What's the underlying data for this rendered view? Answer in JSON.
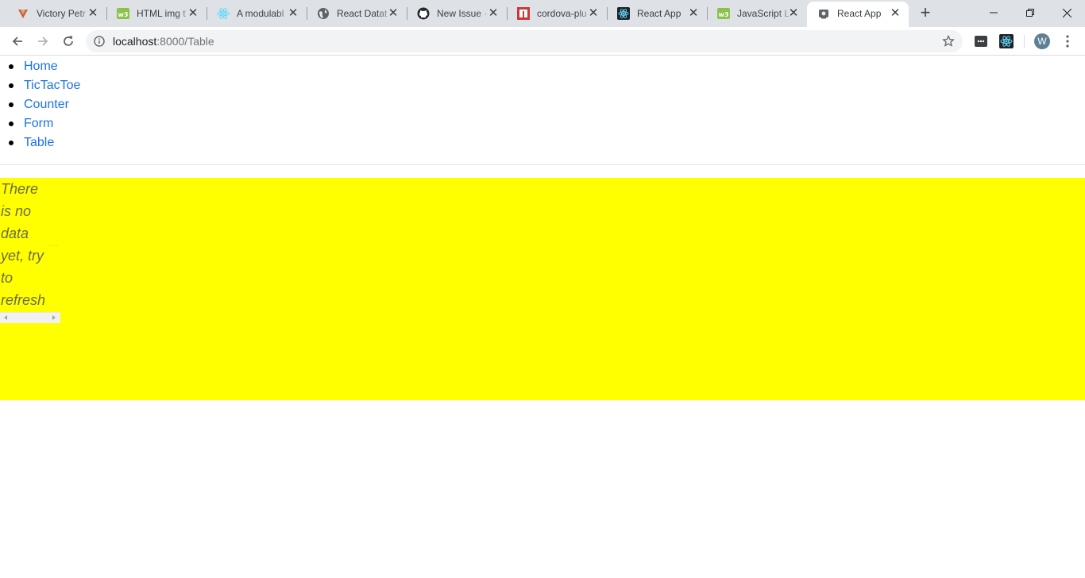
{
  "browser": {
    "tabs": [
      {
        "title": "Victory Petr",
        "icon": "victory-icon"
      },
      {
        "title": "HTML img t",
        "icon": "w3schools-icon"
      },
      {
        "title": "A modulabl",
        "icon": "react-icon"
      },
      {
        "title": "React Datat",
        "icon": "globe-icon"
      },
      {
        "title": "New Issue ·",
        "icon": "github-icon"
      },
      {
        "title": "cordova-plu",
        "icon": "npm-icon"
      },
      {
        "title": "React App",
        "icon": "react-icon"
      },
      {
        "title": "JavaScript L",
        "icon": "w3schools-icon"
      },
      {
        "title": "React App",
        "icon": "react-app-icon",
        "active": true
      }
    ],
    "url_host": "localhost",
    "url_path": ":8000/Table",
    "avatar_letter": "W"
  },
  "nav": {
    "items": [
      "Home",
      "TicTacToe",
      "Counter",
      "Form",
      "Table"
    ]
  },
  "table_area": {
    "empty_message": "There is no data yet, try to refresh",
    "message_lines": [
      "There",
      "is no",
      "data",
      "yet, try",
      "to",
      "refresh"
    ],
    "overflow_marker": "···",
    "background": "#ffff00"
  },
  "colors": {
    "link": "#1a73e8",
    "tabstrip": "#dee1e6"
  }
}
